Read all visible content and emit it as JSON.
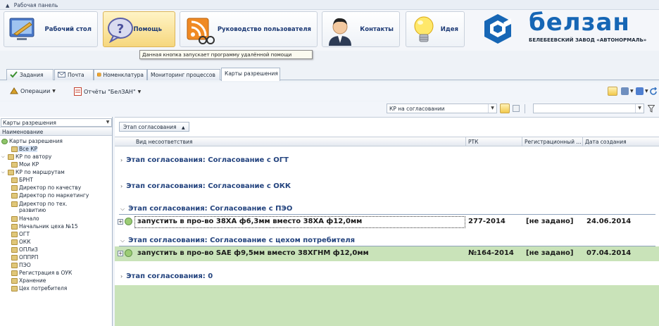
{
  "panel": {
    "title": "Рабочая панель"
  },
  "ribbon": {
    "buttons": [
      {
        "label": "Рабочий стол",
        "icon": "desktop-icon"
      },
      {
        "label": "Помощь",
        "icon": "help-icon"
      },
      {
        "label": "Руководство пользователя",
        "icon": "user-guide-icon"
      },
      {
        "label": "Контакты",
        "icon": "contacts-icon"
      },
      {
        "label": "Идея",
        "icon": "idea-bulb-icon"
      }
    ],
    "tooltip": "Данная кнопка запускает программу удалённой помощи"
  },
  "logo": {
    "name": "белзан",
    "subtitle": "БЕЛЕБЕЕВСКИЙ ЗАВОД «АВТОНОРМАЛЬ»"
  },
  "tabs": [
    "Задания",
    "Почта",
    "Номенклатура",
    "Мониторинг процессов",
    "Карты разрешения"
  ],
  "toolbar": {
    "operations": "Операции",
    "reports": "Отчёты \"БелЗАН\""
  },
  "filter": {
    "status_value": "КР на согласовании",
    "search_value": ""
  },
  "tree": {
    "combo_value": "Карты разрешения",
    "header": "Наименование",
    "nodes": [
      "Карты разрешения",
      "Все КР",
      "КР по автору",
      "Мои КР",
      "КР по маршрутам",
      "БРНТ",
      "Директор по качеству",
      "Директор по маркетингу",
      "Директор по тех. развитию",
      "Начало",
      "Начальник цеха №15",
      "ОГТ",
      "ОКК",
      "ОПЛиЗ",
      "ОППРП",
      "ПЭО",
      "Регистрация в ОУК",
      "Хранение",
      "Цех потребителя"
    ]
  },
  "grid": {
    "group_by": "Этап согласования",
    "columns": [
      "Вид несоответствия",
      "РТК",
      "Регистрационный ...",
      "Дата создания"
    ],
    "groups": [
      {
        "label": "Этап согласования: Согласование с ОГТ"
      },
      {
        "label": "Этап согласования: Согласование с ОКК"
      },
      {
        "label": "Этап согласования: Согласование с ПЭО"
      },
      {
        "label": "Этап согласования: Согласование с цехом потребителя"
      },
      {
        "label": "Этап согласования: 0"
      }
    ],
    "rows": [
      {
        "desc": "запустить в про-во 38ХА ф6,3мм вместо 38ХА ф12,0мм",
        "rtk": "277-2014",
        "reg": "[не задано]",
        "date": "24.06.2014"
      },
      {
        "desc": "запустить в про-во SAE ф9,5мм вместо 38ХГНМ ф12,0мм",
        "rtk": "№164-2014",
        "reg": "[не задано]",
        "date": "07.04.2014"
      }
    ]
  },
  "colors": {
    "accent": "#1666b5",
    "row_highlight": "#c9e3b9",
    "group_text": "#23437e"
  }
}
